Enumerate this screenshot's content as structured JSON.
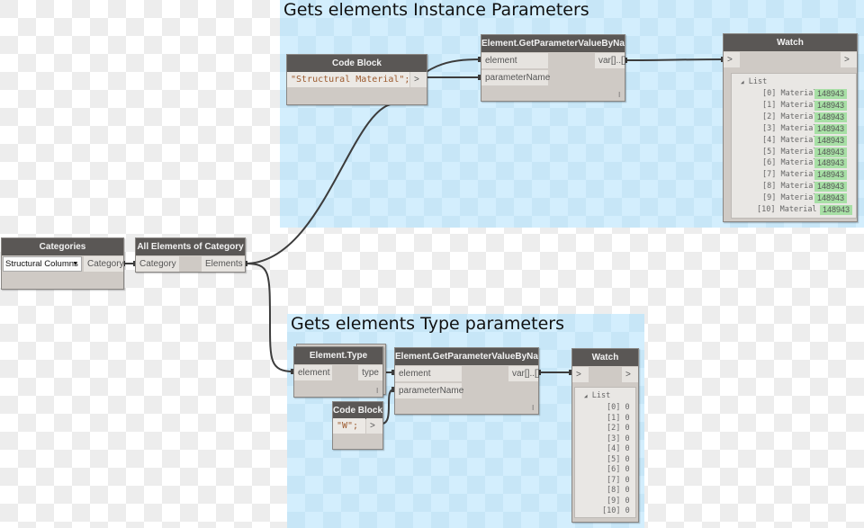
{
  "groups": [
    {
      "title": "Gets elements Instance Parameters"
    },
    {
      "title": "Gets elements Type parameters"
    }
  ],
  "nodes": {
    "categories": {
      "title": "Categories",
      "selected": "Structural Columns",
      "dropdown_icon": "chevron-down-icon",
      "output": "Category"
    },
    "all_elements": {
      "title": "All Elements of Category",
      "input": "Category",
      "output": "Elements"
    },
    "code_block_1": {
      "title": "Code Block",
      "code": "\"Structural Material\";",
      "output": ">"
    },
    "get_param_1": {
      "title": "Element.GetParameterValueByName",
      "inputs": [
        "element",
        "parameterName"
      ],
      "output": "var[]..[]",
      "lacing": "l"
    },
    "watch_1": {
      "title": "Watch",
      "input": ">",
      "output": ">",
      "list_label": "List",
      "items": [
        {
          "index": "[0]",
          "label": "Material",
          "value": "148943"
        },
        {
          "index": "[1]",
          "label": "Material",
          "value": "148943"
        },
        {
          "index": "[2]",
          "label": "Material",
          "value": "148943"
        },
        {
          "index": "[3]",
          "label": "Material",
          "value": "148943"
        },
        {
          "index": "[4]",
          "label": "Material",
          "value": "148943"
        },
        {
          "index": "[5]",
          "label": "Material",
          "value": "148943"
        },
        {
          "index": "[6]",
          "label": "Material",
          "value": "148943"
        },
        {
          "index": "[7]",
          "label": "Material",
          "value": "148943"
        },
        {
          "index": "[8]",
          "label": "Material",
          "value": "148943"
        },
        {
          "index": "[9]",
          "label": "Material",
          "value": "148943"
        },
        {
          "index": "[10]",
          "label": "Material",
          "value": "148943"
        }
      ]
    },
    "element_type": {
      "title": "Element.Type",
      "input": "element",
      "output": "type",
      "lacing": "l"
    },
    "code_block_2": {
      "title": "Code Block",
      "code": "\"W\";",
      "output": ">"
    },
    "get_param_2": {
      "title": "Element.GetParameterValueByName",
      "inputs": [
        "element",
        "parameterName"
      ],
      "output": "var[]..[]",
      "lacing": "l"
    },
    "watch_2": {
      "title": "Watch",
      "input": ">",
      "output": ">",
      "list_label": "List",
      "items": [
        {
          "index": "[0]",
          "value": "0"
        },
        {
          "index": "[1]",
          "value": "0"
        },
        {
          "index": "[2]",
          "value": "0"
        },
        {
          "index": "[3]",
          "value": "0"
        },
        {
          "index": "[4]",
          "value": "0"
        },
        {
          "index": "[5]",
          "value": "0"
        },
        {
          "index": "[6]",
          "value": "0"
        },
        {
          "index": "[7]",
          "value": "0"
        },
        {
          "index": "[8]",
          "value": "0"
        },
        {
          "index": "[9]",
          "value": "0"
        },
        {
          "index": "[10]",
          "value": "0"
        }
      ]
    }
  },
  "colors": {
    "node_header": "#5a5755",
    "node_body": "#cfcac5",
    "group_bg": "#d3eefd",
    "watch_value_bg": "#a7dfa5",
    "wire": "#3c3c3c"
  }
}
